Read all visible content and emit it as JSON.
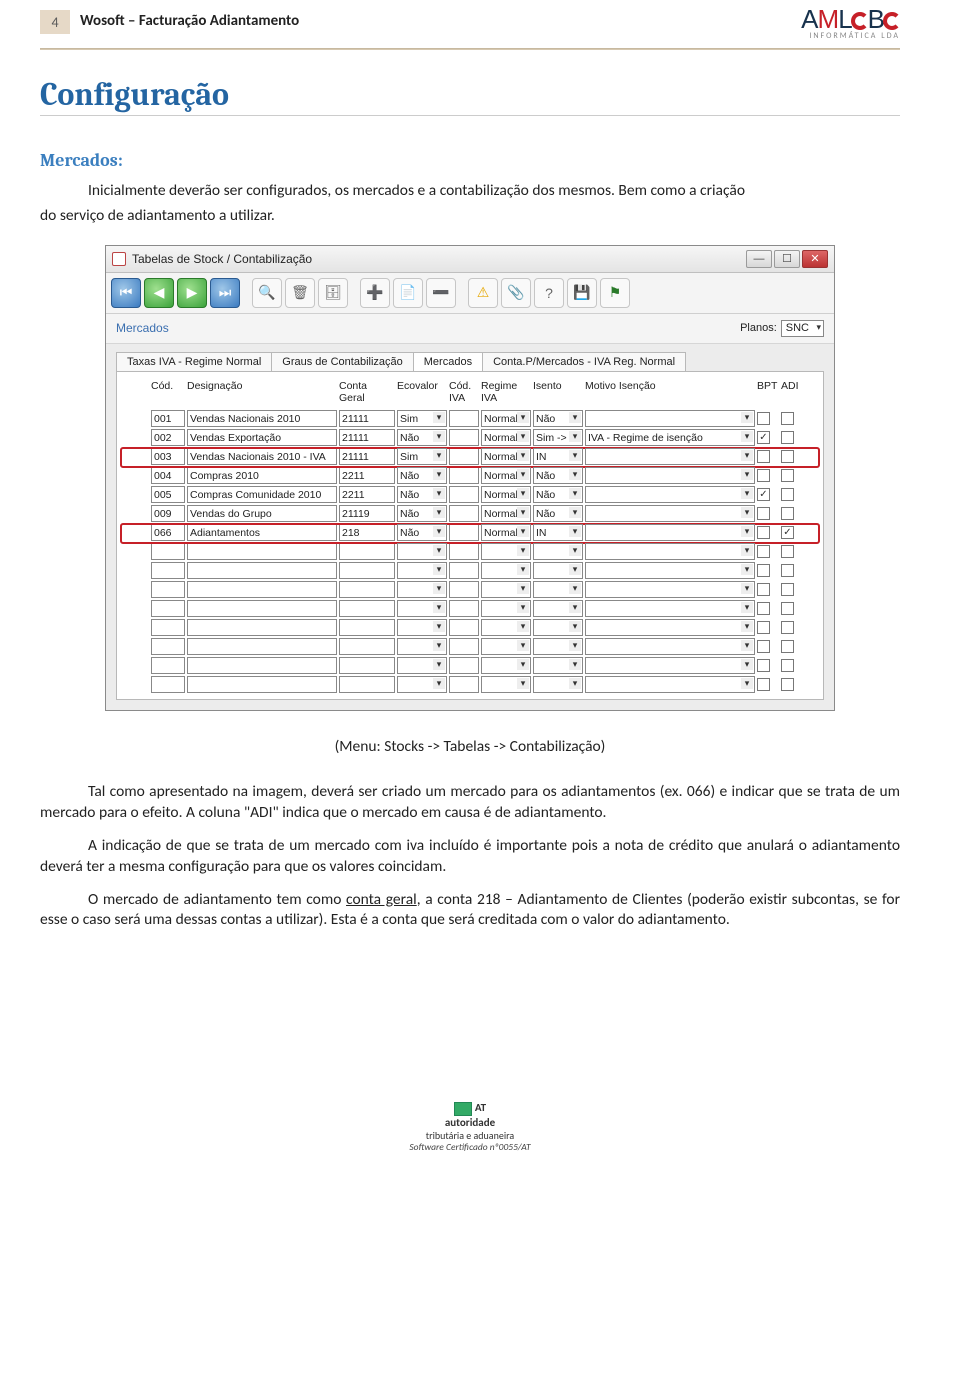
{
  "page_number": "4",
  "doc_title": "Wosoft – Facturação Adiantamento",
  "logo": {
    "brand_red_letter": "M",
    "brand_text": "AMLOB",
    "tag": "INFORMÁTICA LDA"
  },
  "h1": "Configuração",
  "h2": "Mercados:",
  "intro1": "Inicialmente deverão ser configurados, os mercados e a contabilização dos mesmos. Bem como a criação",
  "intro2": "do serviço de adiantamento a utilizar.",
  "caption": "(Menu: Stocks -> Tabelas -> Contabilização)",
  "p1a": "Tal como apresentado na imagem, deverá ser criado um mercado para os adiantamentos (ex. 066) e",
  "p1b": "indicar que se trata de um mercado para o efeito. A coluna \"ADI\" indica que o mercado em causa é de adiantamento.",
  "p2": "A indicação de que se trata de um mercado com iva incluído é importante pois a nota de crédito que anulará o adiantamento deverá ter a mesma configuração para que os valores coincidam.",
  "p3_a": "O mercado de adiantamento tem como ",
  "p3_u": "conta geral",
  "p3_b": ", a conta 218 – Adiantamento de Clientes (poderão existir subcontas, se for esse o caso será uma dessas contas a utilizar). Esta é a conta que será creditada com o valor do adiantamento.",
  "win": {
    "title": "Tabelas de Stock / Contabilização",
    "subheader": "Mercados",
    "planos_label": "Planos:",
    "planos_value": "SNC",
    "tabs": [
      "Taxas IVA - Regime Normal",
      "Graus de Contabilização",
      "Mercados",
      "Conta.P/Mercados - IVA Reg. Normal"
    ],
    "active_tab": 2,
    "headers": {
      "cod": "Cód.",
      "desig": "Designação",
      "conta": "Conta Geral",
      "eco": "Ecovalor",
      "codiva": "Cód. IVA",
      "regime": "Regime IVA",
      "isento": "Isento",
      "motivo": "Motivo Isenção",
      "bpt": "BPT",
      "adi": "ADI"
    },
    "rows": [
      {
        "cod": "001",
        "desig": "Vendas Nacionais 2010",
        "conta": "21111",
        "eco": "Sim",
        "codiva": "",
        "regime": "Normal",
        "isento": "Não",
        "motivo": "",
        "bpt": false,
        "adi": false,
        "hl": false
      },
      {
        "cod": "002",
        "desig": "Vendas Exportação",
        "conta": "21111",
        "eco": "Não",
        "codiva": "",
        "regime": "Normal",
        "isento": "Sim ->",
        "motivo": "IVA - Regime de isenção",
        "bpt": true,
        "adi": false,
        "hl": false
      },
      {
        "cod": "003",
        "desig": "Vendas Nacionais 2010 - IVA",
        "conta": "21111",
        "eco": "Sim",
        "codiva": "",
        "regime": "Normal",
        "isento": "IN",
        "motivo": "",
        "bpt": false,
        "adi": false,
        "hl": true
      },
      {
        "cod": "004",
        "desig": "Compras 2010",
        "conta": "2211",
        "eco": "Não",
        "codiva": "",
        "regime": "Normal",
        "isento": "Não",
        "motivo": "",
        "bpt": false,
        "adi": false,
        "hl": false
      },
      {
        "cod": "005",
        "desig": "Compras Comunidade 2010",
        "conta": "2211",
        "eco": "Não",
        "codiva": "",
        "regime": "Normal",
        "isento": "Não",
        "motivo": "",
        "bpt": true,
        "adi": false,
        "hl": false
      },
      {
        "cod": "009",
        "desig": "Vendas do Grupo",
        "conta": "21119",
        "eco": "Não",
        "codiva": "",
        "regime": "Normal",
        "isento": "Não",
        "motivo": "",
        "bpt": false,
        "adi": false,
        "hl": false
      },
      {
        "cod": "066",
        "desig": "Adiantamentos",
        "conta": "218",
        "eco": "Não",
        "codiva": "",
        "regime": "Normal",
        "isento": "IN",
        "motivo": "",
        "bpt": false,
        "adi": true,
        "hl": true
      }
    ],
    "empty_rows": 8
  },
  "cert": {
    "line1": "AT",
    "line2": "autoridade",
    "line3": "tributária e aduaneira",
    "line4": "Software Certificado nº0055/AT"
  }
}
